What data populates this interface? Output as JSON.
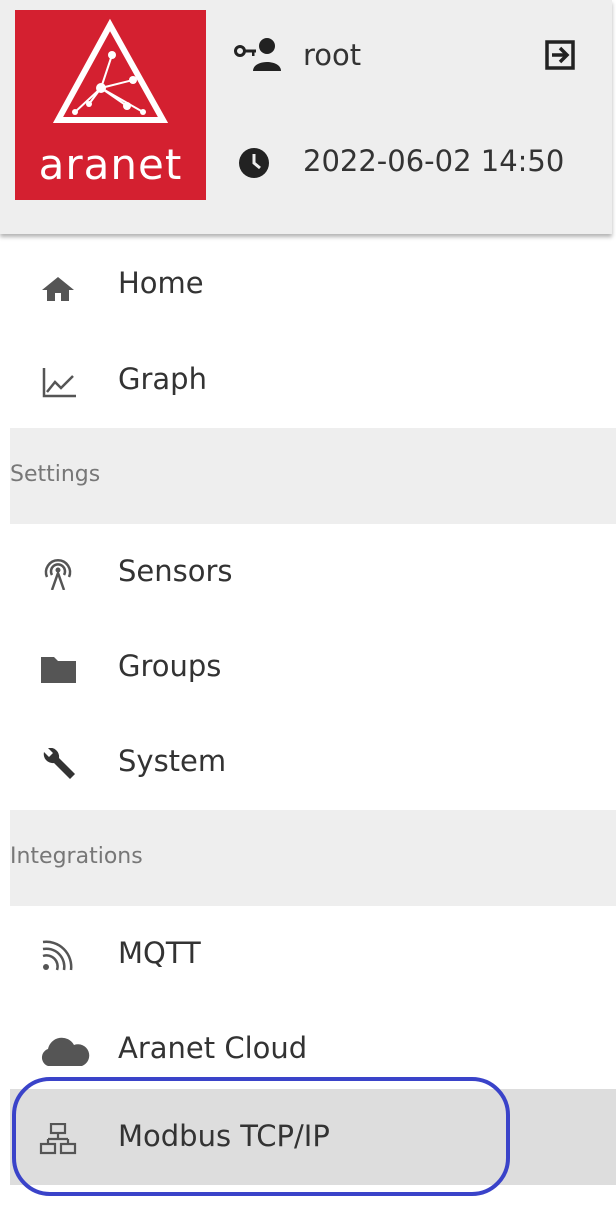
{
  "header": {
    "logo_text": "aranet",
    "username": "root",
    "datetime": "2022-06-02 14:50",
    "brand_color": "#d42030"
  },
  "nav": {
    "items": [
      {
        "label": "Home",
        "icon": "home-icon"
      },
      {
        "label": "Graph",
        "icon": "graph-icon"
      }
    ],
    "settings_section": {
      "title": "Settings",
      "items": [
        {
          "label": "Sensors",
          "icon": "sensors-icon"
        },
        {
          "label": "Groups",
          "icon": "folder-icon"
        },
        {
          "label": "System",
          "icon": "wrench-icon"
        }
      ]
    },
    "integrations_section": {
      "title": "Integrations",
      "items": [
        {
          "label": "MQTT",
          "icon": "rss-icon"
        },
        {
          "label": "Aranet Cloud",
          "icon": "cloud-icon"
        },
        {
          "label": "Modbus TCP/IP",
          "icon": "network-icon",
          "active": true
        }
      ]
    }
  },
  "annotation": {
    "color": "#3a43c9"
  }
}
